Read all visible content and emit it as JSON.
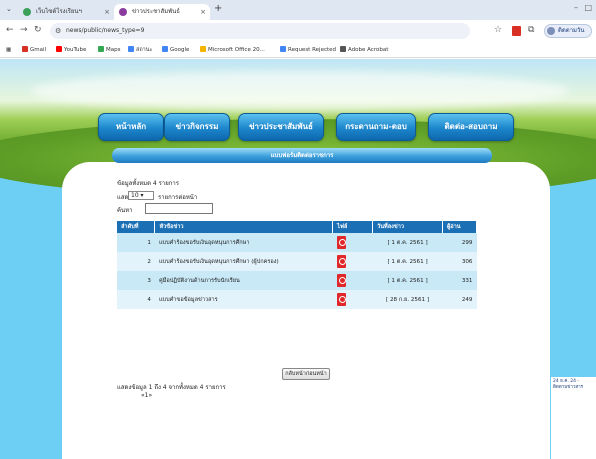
{
  "browser": {
    "tabs": [
      {
        "title": "เว็บไซต์โรงเรียนฯ"
      },
      {
        "title": "ข่าวประชาสัมพันธ์"
      }
    ],
    "url": "news/public/news_type=9",
    "profile_label": "ติดตามวัน",
    "bookmarks": [
      {
        "label": "Gmail",
        "color": "#d93025"
      },
      {
        "label": "YouTube",
        "color": "#ff0000"
      },
      {
        "label": "Maps",
        "color": "#34a853"
      },
      {
        "label": "สถานะ",
        "color": "#4285f4"
      },
      {
        "label": "Google",
        "color": "#4285f4"
      },
      {
        "label": "Microsoft Office 20...",
        "color": "#f4b400"
      },
      {
        "label": "Request Rejected",
        "color": "#4285f4"
      },
      {
        "label": "Adobe Acrobat",
        "color": "#555555"
      }
    ]
  },
  "nav": {
    "home": "หน้าหลัก",
    "activities": "ข่าวกิจกรรม",
    "news": "ข่าวประชาสัมพันธ์",
    "board": "กระดานถาม-ตอบ",
    "contact": "ติดต่อ-สอบถาม"
  },
  "section_title": "แบบฟอร์มติดต่อราชการ",
  "list": {
    "count_text": "ข้อมูลทั้งหมด 4 รายการ",
    "show_label": "แสดง",
    "page_size": "10",
    "per_page_label": "รายการต่อหน้า",
    "search_label": "ค้นหา",
    "columns": {
      "no": "ลำดับที่",
      "title": "หัวข้อข่าว",
      "file": "ไฟล์",
      "date": "วันที่ลงข่าว",
      "views": "ผู้อ่าน"
    },
    "rows": [
      {
        "no": "1",
        "title": "แบบคำร้องขอรับเงินอุดหนุนการศึกษา",
        "date": "[ 1 ต.ค. 2561 ]",
        "views": "299"
      },
      {
        "no": "2",
        "title": "แบบคำร้องขอรับเงินอุดหนุนการศึกษา (ผู้ปกครอง)",
        "date": "[ 1 ต.ค. 2561 ]",
        "views": "306"
      },
      {
        "no": "3",
        "title": "คู่มือปฏิบัติงานด้านการรับนักเรียน",
        "date": "[ 1 ต.ค. 2561 ]",
        "views": "331"
      },
      {
        "no": "4",
        "title": "แบบคำขอข้อมูลข่าวสาร",
        "date": "[ 28 ก.ย. 2561 ]",
        "views": "249"
      }
    ],
    "footer_text": "แสดงข้อมูล 1 ถึง 4 จากทั้งหมด 4 รายการ",
    "pager": "«1»"
  },
  "back_button": "กลับหน้าก่อนหน้า",
  "side_popup": "24 ธ.ค. 24 - ติดตามข่าวสาร"
}
